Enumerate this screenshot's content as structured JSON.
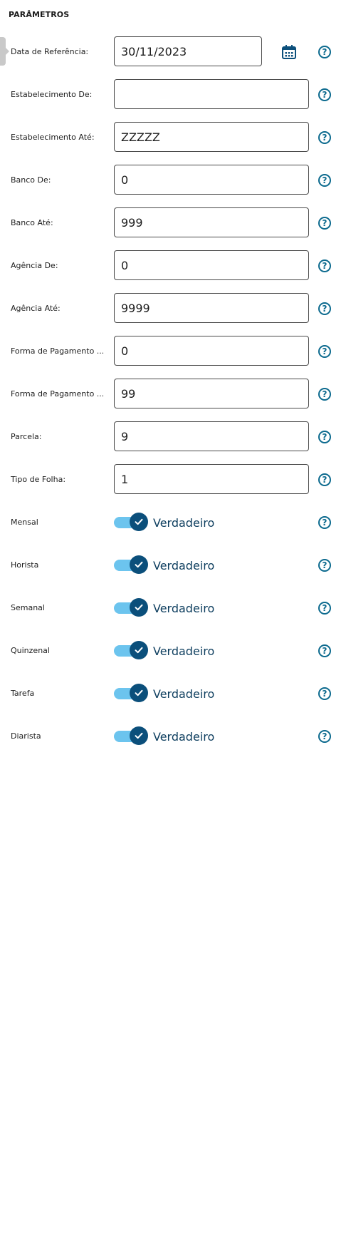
{
  "section": {
    "title": "PARÂMETROS"
  },
  "icons": {
    "calendar": "calendar-icon",
    "help": "help-circle-icon",
    "check": "check-icon"
  },
  "colors": {
    "primary": "#0b4f7b",
    "switch_track": "#6cc4ee",
    "help": "#0c6a8e"
  },
  "fields": [
    {
      "label": "Data de Referência:",
      "value": "30/11/2023"
    },
    {
      "label": "Estabelecimento De:",
      "value": ""
    },
    {
      "label": "Estabelecimento Até:",
      "value": "ZZZZZ"
    },
    {
      "label": "Banco De:",
      "value": "0"
    },
    {
      "label": "Banco Até:",
      "value": "999"
    },
    {
      "label": "Agência De:",
      "value": "0"
    },
    {
      "label": "Agência Até:",
      "value": "9999"
    },
    {
      "label": "Forma de Pagamento ...",
      "value": "0"
    },
    {
      "label": "Forma de Pagamento ...",
      "value": "99"
    },
    {
      "label": "Parcela:",
      "value": "9"
    },
    {
      "label": "Tipo de Folha:",
      "value": "1"
    }
  ],
  "help_glyph": "?",
  "toggles": [
    {
      "label": "Mensal",
      "state": "Verdadeiro",
      "checked": true
    },
    {
      "label": "Horista",
      "state": "Verdadeiro",
      "checked": true
    },
    {
      "label": "Semanal",
      "state": "Verdadeiro",
      "checked": true
    },
    {
      "label": "Quinzenal",
      "state": "Verdadeiro",
      "checked": true
    },
    {
      "label": "Tarefa",
      "state": "Verdadeiro",
      "checked": true
    },
    {
      "label": "Diarista",
      "state": "Verdadeiro",
      "checked": true
    }
  ]
}
